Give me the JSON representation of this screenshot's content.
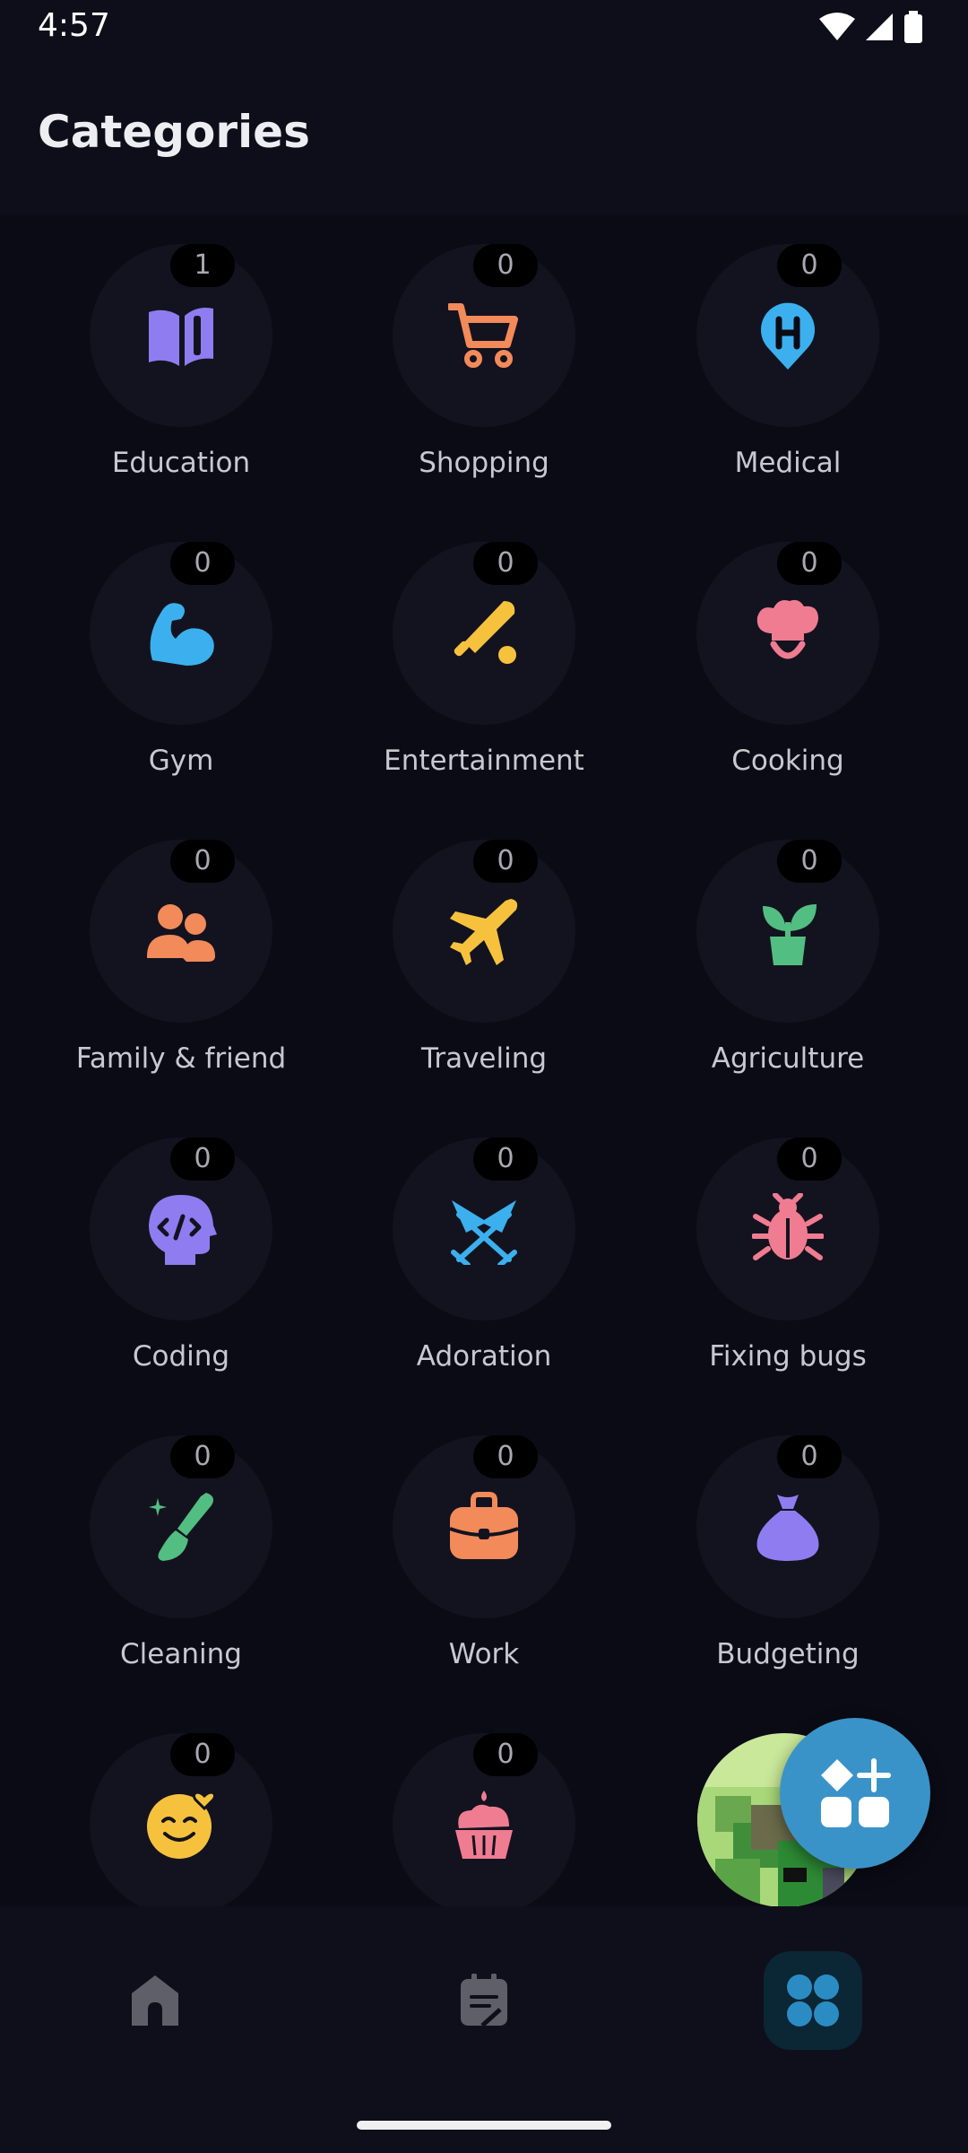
{
  "status": {
    "time": "4:57"
  },
  "header": {
    "title": "Categories"
  },
  "categories": [
    {
      "label": "Education",
      "count": "1",
      "icon": "book-icon",
      "color": "#8f7cf0"
    },
    {
      "label": "Shopping",
      "count": "0",
      "icon": "cart-icon",
      "color": "#f28a5a"
    },
    {
      "label": "Medical",
      "count": "0",
      "icon": "hospital-pin-icon",
      "color": "#3cb0ee"
    },
    {
      "label": "Gym",
      "count": "0",
      "icon": "muscle-icon",
      "color": "#3cb0ee"
    },
    {
      "label": "Entertainment",
      "count": "0",
      "icon": "baseball-bat-icon",
      "color": "#f6c23e"
    },
    {
      "label": "Cooking",
      "count": "0",
      "icon": "chef-hat-icon",
      "color": "#f07c92"
    },
    {
      "label": "Family & friend",
      "count": "0",
      "icon": "people-icon",
      "color": "#f28a5a"
    },
    {
      "label": "Traveling",
      "count": "0",
      "icon": "airplane-icon",
      "color": "#f6c23e"
    },
    {
      "label": "Agriculture",
      "count": "0",
      "icon": "plant-icon",
      "color": "#53be82"
    },
    {
      "label": "Coding",
      "count": "0",
      "icon": "code-head-icon",
      "color": "#8f7cf0"
    },
    {
      "label": "Adoration",
      "count": "0",
      "icon": "adoration-icon",
      "color": "#3cb0ee"
    },
    {
      "label": "Fixing bugs",
      "count": "0",
      "icon": "bug-icon",
      "color": "#f07c92"
    },
    {
      "label": "Cleaning",
      "count": "0",
      "icon": "broom-icon",
      "color": "#53be82"
    },
    {
      "label": "Work",
      "count": "0",
      "icon": "briefcase-icon",
      "color": "#f28a5a"
    },
    {
      "label": "Budgeting",
      "count": "0",
      "icon": "money-bag-icon",
      "color": "#8f7cf0"
    },
    {
      "label": "",
      "count": "0",
      "icon": "smiley-icon",
      "color": "#f6c23e"
    },
    {
      "label": "",
      "count": "0",
      "icon": "cupcake-icon",
      "color": "#f07c92"
    }
  ],
  "nav": {
    "items": [
      {
        "icon": "home-icon",
        "active": false
      },
      {
        "icon": "notes-icon",
        "active": false
      },
      {
        "icon": "categories-icon",
        "active": true
      }
    ]
  },
  "fab": {
    "icon": "add-category-icon"
  }
}
